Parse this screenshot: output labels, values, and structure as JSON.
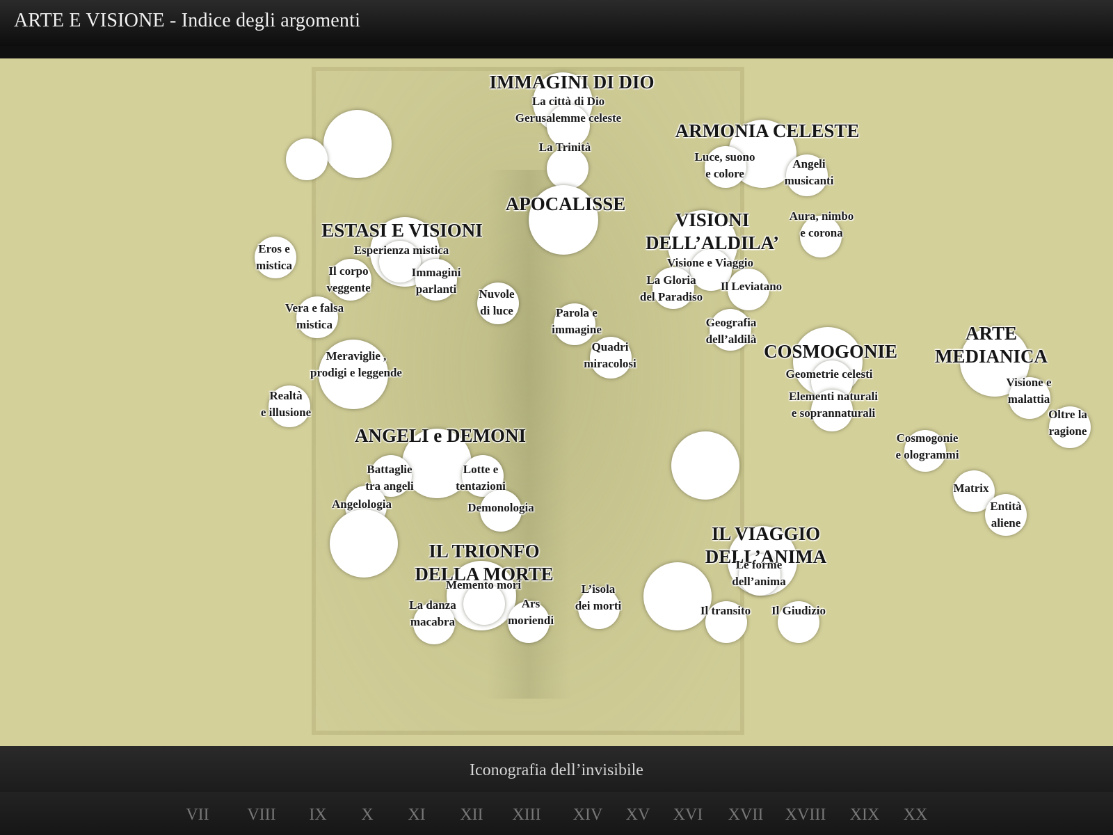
{
  "window": {
    "title": "ARTE E VISIONE - Indice degli argomenti"
  },
  "map": {
    "topics": [
      {
        "id": "immagini-di-dio",
        "title": "IMMAGINI DI DIO",
        "items": [
          "La città di Dio\nGerusalemme celeste",
          "La Trinità"
        ]
      },
      {
        "id": "armonia-celeste",
        "title": "ARMONIA CELESTE",
        "items": [
          "Luce, suono\ne colore",
          "Angeli\nmusicanti",
          "Aura, nimbo\ne corona"
        ]
      },
      {
        "id": "apocalisse",
        "title": "APOCALISSE",
        "items": []
      },
      {
        "id": "estasi-e-visioni",
        "title": "ESTASI E VISIONI",
        "items": [
          "Esperienza mistica",
          "Eros e\nmistica",
          "Il corpo\nveggente",
          "Immagini\nparlanti",
          "Vera e falsa\nmistica",
          "Meraviglie ,\nprodigi e leggende",
          "Realtà\ne illusione"
        ]
      },
      {
        "id": "visioni-aldila",
        "title": "VISIONI\nDELL’ALDILA’",
        "items": [
          "Visione e Viaggio",
          "La Gloria\ndel Paradiso",
          "Il Leviatano",
          "Geografia\ndell’aldilà"
        ]
      },
      {
        "id": "misc",
        "title": "",
        "items": [
          "Nuvole\ndi luce",
          "Parola e\nimmagine",
          "Quadri\nmiracolosi",
          "L’isola\ndei morti"
        ]
      },
      {
        "id": "cosmogonie",
        "title": "COSMOGONIE",
        "items": [
          "Geometrie celesti",
          "Elementi naturali\ne soprannaturali"
        ]
      },
      {
        "id": "arte-medianica",
        "title": "ARTE\nMEDIANICA",
        "items": [
          "Visione e\nmalattia",
          "Oltre la\nragione",
          "Cosmogonie\ne ologrammi",
          "Matrix",
          "Entità\naliene"
        ]
      },
      {
        "id": "angeli-e-demoni",
        "title": "ANGELI e DEMONI",
        "items": [
          "Battaglie\ntra angeli",
          "Lotte e\ntentazioni",
          "Angelologia",
          "Demonologia"
        ]
      },
      {
        "id": "trionfo-della-morte",
        "title": "IL TRIONFO\nDELLA MORTE",
        "items": [
          "Memento mori",
          "La danza\nmacabra",
          "Ars\nmoriendi"
        ]
      },
      {
        "id": "viaggio-anima",
        "title": "IL VIAGGIO\nDELL’ANIMA",
        "items": [
          "Le forme\ndell’anima",
          "Il transito",
          "Il Giudizio"
        ]
      }
    ]
  },
  "footer": {
    "subtitle": "Iconografia dell’invisibile",
    "centuries": [
      "VII",
      "VIII",
      "IX",
      "X",
      "XI",
      "XII",
      "XIII",
      "XIV",
      "XV",
      "XVI",
      "XVII",
      "XVIII",
      "XIX",
      "XX"
    ]
  }
}
